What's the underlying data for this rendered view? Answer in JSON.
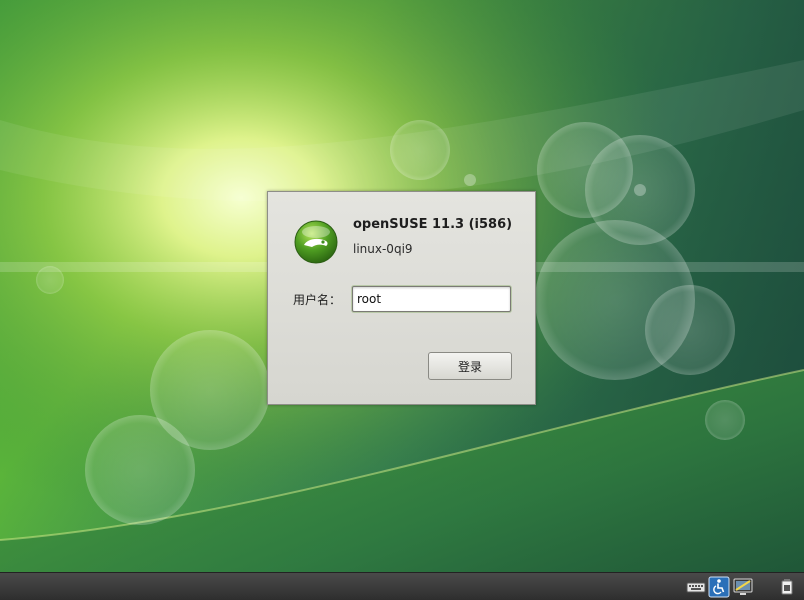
{
  "login_dialog": {
    "title": "openSUSE 11.3 (i586)",
    "hostname": "linux-0qi9",
    "username_label": "用户名：",
    "username_value": "root",
    "login_button_label": "登录"
  },
  "tray": {
    "icons": [
      "keyboard-icon",
      "accessibility-icon",
      "display-icon",
      "power-icon"
    ]
  },
  "colors": {
    "wallpaper_green": "#2f7a4a",
    "wallpaper_glow": "#e8f57a",
    "dialog_bg": "#dcdcd6",
    "taskbar_bg": "#3a3a3a",
    "accessibility_blue": "#2a6fb8",
    "logo_green": "#3f8f1f"
  }
}
